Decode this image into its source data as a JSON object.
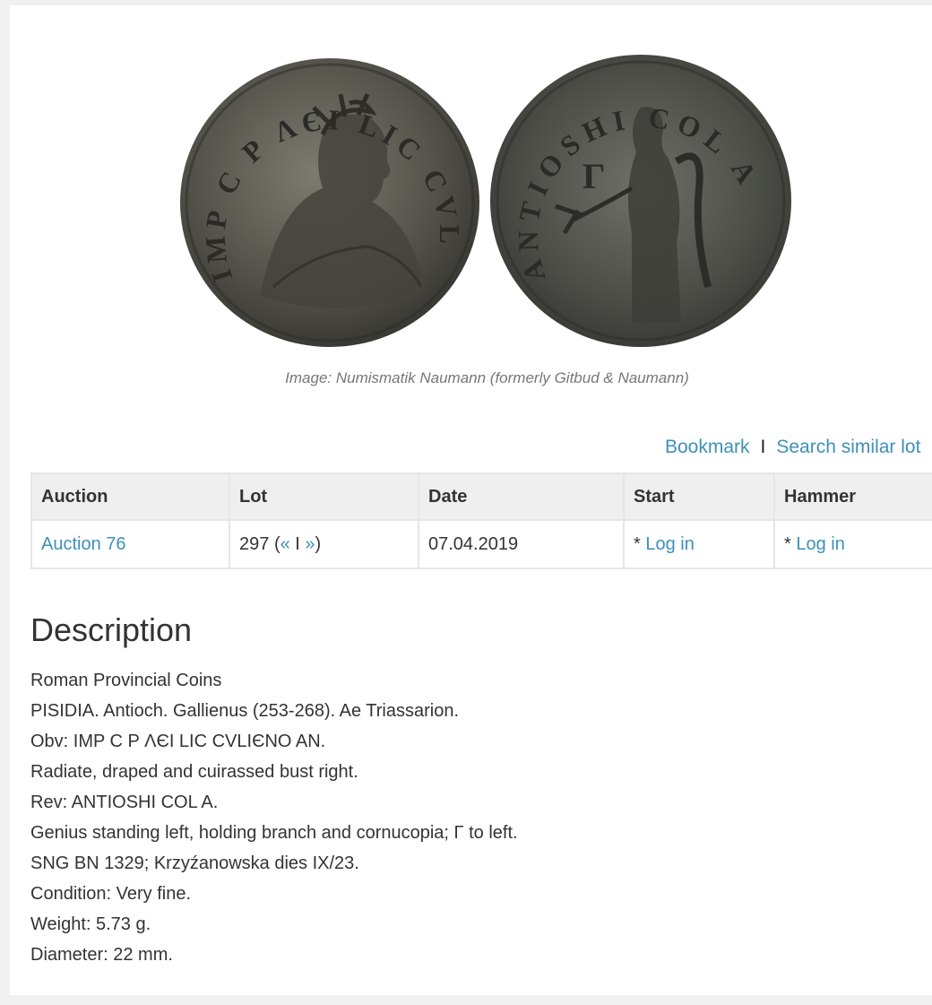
{
  "image_caption": "Image: Numismatik Naumann (formerly Gitbud & Naumann)",
  "coin_images": [
    {
      "side": "obverse",
      "legend": "IMP C P ΛЄI LIC CVLIЄNO AN"
    },
    {
      "side": "reverse",
      "legend": "ANTIOSHI COL A"
    }
  ],
  "actions": {
    "bookmark": "Bookmark",
    "separator": "I",
    "search_similar": "Search similar lot"
  },
  "table": {
    "headers": [
      "Auction",
      "Lot",
      "Date",
      "Start",
      "Hammer"
    ],
    "row": {
      "auction": "Auction 76",
      "lot_number": "297",
      "lot_nav_open": "(",
      "prev": "«",
      "nav_sep": "I",
      "next": "»",
      "lot_nav_close": ")",
      "date": "07.04.2019",
      "start_prefix": "*",
      "start_link": "Log in",
      "hammer_prefix": "*",
      "hammer_link": "Log in"
    }
  },
  "description": {
    "title": "Description",
    "lines": [
      "Roman Provincial Coins",
      "PISIDIA. Antioch. Gallienus (253-268). Ae Triassarion.",
      "Obv: IMP C P ΛЄI LIC CVLIЄNO AN.",
      "Radiate, draped and cuirassed bust right.",
      "Rev: ANTIOSHI COL A.",
      "Genius standing left, holding branch and cornucopia; Γ to left.",
      "SNG BN 1329; Krzyźanowska dies IX/23.",
      "Condition: Very fine.",
      "Weight: 5.73 g.",
      "Diameter: 22 mm."
    ]
  },
  "colors": {
    "link": "#3d8fbd",
    "header_bg": "#efefef",
    "text": "#333333"
  }
}
